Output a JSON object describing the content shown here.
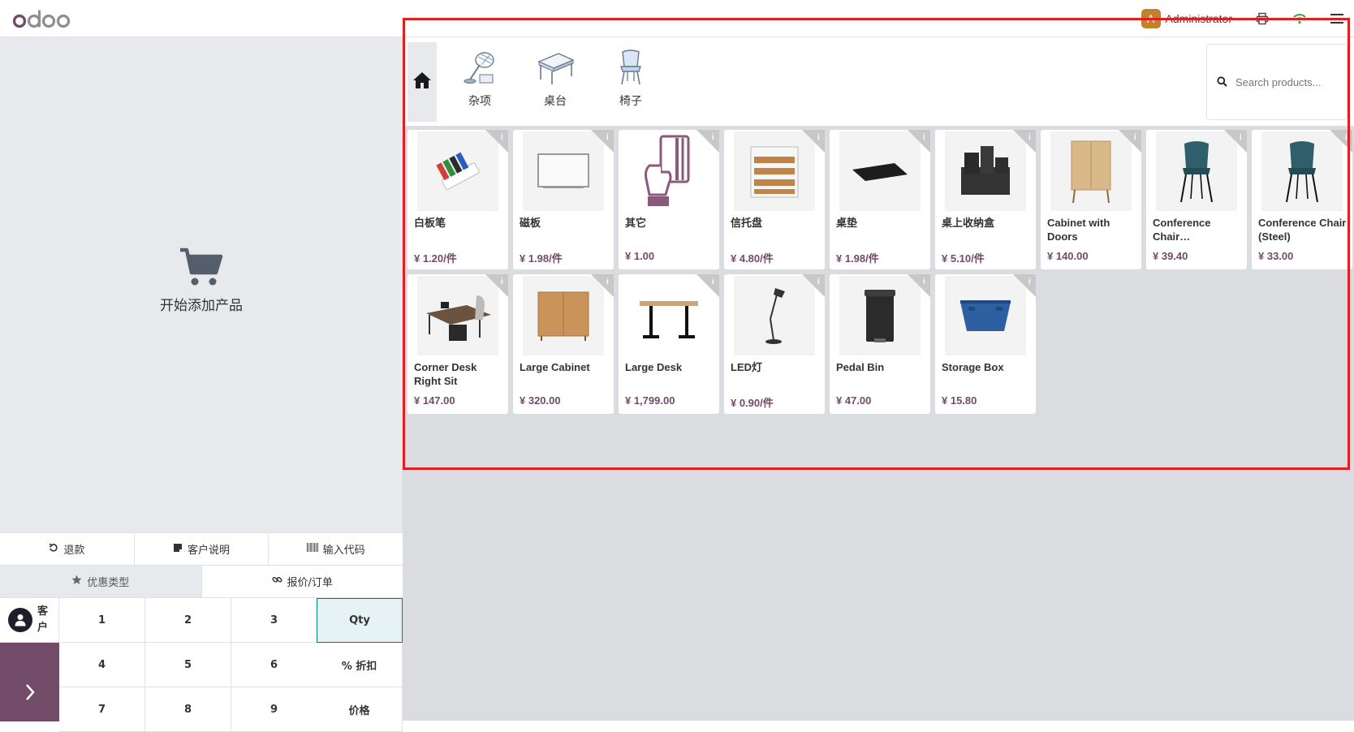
{
  "topbar": {
    "logo": "odoo",
    "user_initial": "A",
    "user_name": "Administrator"
  },
  "left": {
    "empty_message": "开始添加产品",
    "controls_row1": [
      "退款",
      "客户说明",
      "输入代码"
    ],
    "controls_row2": [
      "优惠类型",
      "报价/订单"
    ],
    "customer_label": "客户",
    "keys": [
      "1",
      "2",
      "3",
      "Qty",
      "4",
      "5",
      "6",
      "% 折扣",
      "7",
      "8",
      "9",
      "价格"
    ]
  },
  "categories": [
    {
      "label": "杂项",
      "icon": "misc-desk-lamp-icon"
    },
    {
      "label": "桌台",
      "icon": "desk-icon"
    },
    {
      "label": "椅子",
      "icon": "chair-icon"
    }
  ],
  "search": {
    "placeholder": "Search products..."
  },
  "products": [
    {
      "name": "白板笔",
      "price": "¥ 1.20/件",
      "image": "whiteboard-markers"
    },
    {
      "name": "磁板",
      "price": "¥ 1.98/件",
      "image": "whiteboard"
    },
    {
      "name": "其它",
      "price": "¥ 1.00",
      "image": "card-hand"
    },
    {
      "name": "信托盘",
      "price": "¥ 4.80/件",
      "image": "letter-tray"
    },
    {
      "name": "桌垫",
      "price": "¥ 1.98/件",
      "image": "desk-pad"
    },
    {
      "name": "桌上收纳盒",
      "price": "¥ 5.10/件",
      "image": "desk-organizer"
    },
    {
      "name": "Cabinet with Doors",
      "price": "¥ 140.00",
      "image": "cabinet-doors"
    },
    {
      "name": "Conference Chair…",
      "price": "¥ 39.40",
      "image": "conference-chair"
    },
    {
      "name": "Conference Chair (Steel)",
      "price": "¥ 33.00",
      "image": "conference-chair-steel"
    },
    {
      "name": "Corner Desk Right Sit",
      "price": "¥ 147.00",
      "image": "corner-desk"
    },
    {
      "name": "Large Cabinet",
      "price": "¥ 320.00",
      "image": "large-cabinet"
    },
    {
      "name": "Large Desk",
      "price": "¥ 1,799.00",
      "image": "large-desk"
    },
    {
      "name": "LED灯",
      "price": "¥ 0.90/件",
      "image": "led-lamp"
    },
    {
      "name": "Pedal Bin",
      "price": "¥ 47.00",
      "image": "pedal-bin"
    },
    {
      "name": "Storage Box",
      "price": "¥ 15.80",
      "image": "storage-box"
    }
  ],
  "colors": {
    "brand": "#714b67",
    "accent": "#017e84",
    "highlight": "#e02020"
  }
}
